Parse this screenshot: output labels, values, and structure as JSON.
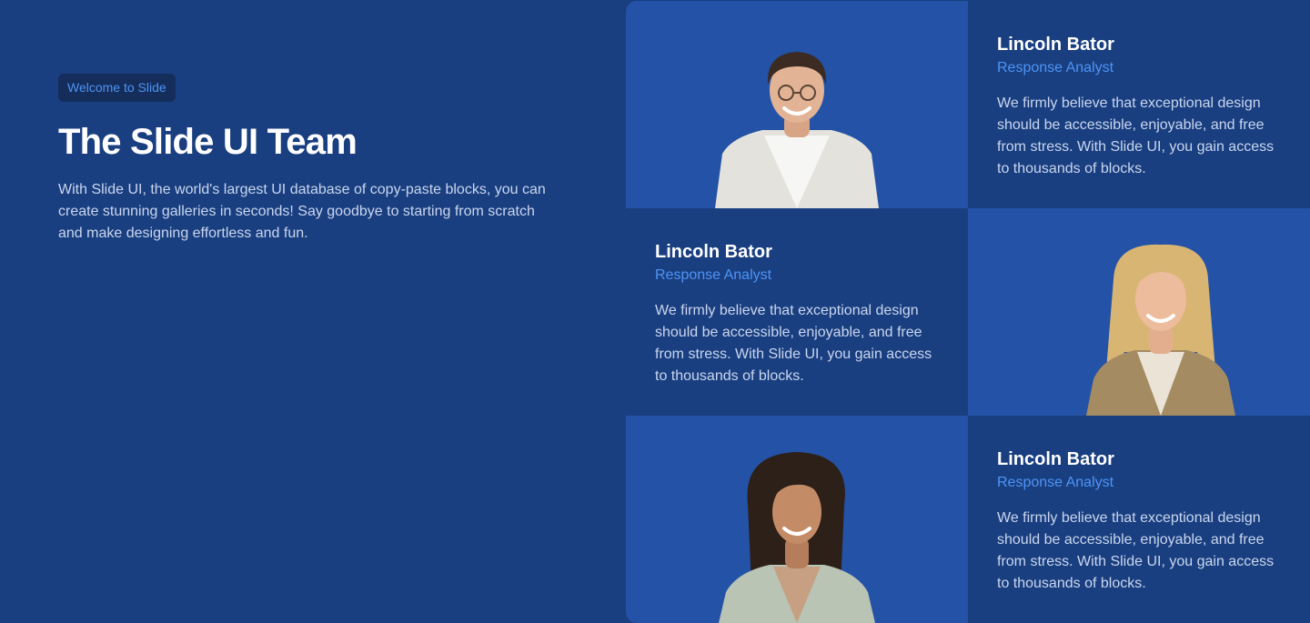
{
  "intro": {
    "badge": "Welcome to Slide",
    "title": "The Slide UI Team",
    "text": "With Slide UI, the world's largest UI database of copy-paste blocks, you can create stunning galleries in seconds! Say goodbye to starting from scratch and make designing effortless and fun."
  },
  "members": [
    {
      "name": "Lincoln Bator",
      "role": "Response Analyst",
      "bio": "We firmly believe that exceptional design should be accessible, enjoyable, and free from stress. With Slide UI, you gain access to thousands of blocks."
    },
    {
      "name": "Lincoln Bator",
      "role": "Response Analyst",
      "bio": "We firmly believe that exceptional design should be accessible, enjoyable, and free from stress. With Slide UI, you gain access to thousands of blocks."
    },
    {
      "name": "Lincoln Bator",
      "role": "Response Analyst",
      "bio": "We firmly believe that exceptional design should be accessible, enjoyable, and free from stress. With Slide UI, you gain access to thousands of blocks."
    }
  ],
  "colors": {
    "background": "#1a3f80",
    "photo_background": "#2452a6",
    "accent": "#4d94f5",
    "badge_background": "#152d5a"
  }
}
